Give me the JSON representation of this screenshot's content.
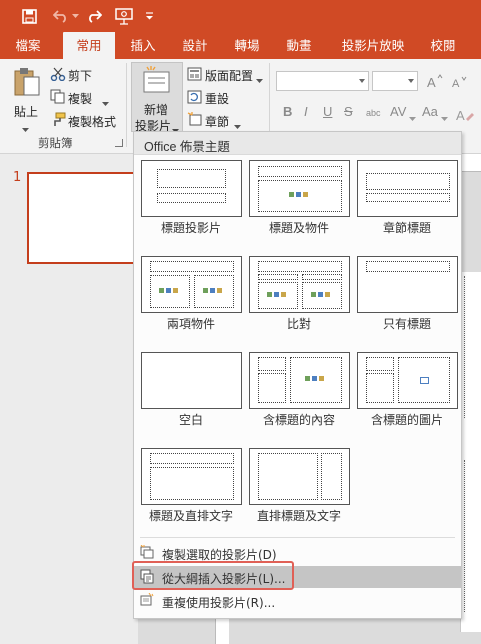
{
  "quick_access": {
    "save_icon": "save-icon",
    "undo_icon": "undo-icon",
    "redo_icon": "redo-icon",
    "present_icon": "present-from-start-icon"
  },
  "tabs": [
    {
      "label": "檔案"
    },
    {
      "label": "常用",
      "active": true
    },
    {
      "label": "插入"
    },
    {
      "label": "設計"
    },
    {
      "label": "轉場"
    },
    {
      "label": "動畫"
    },
    {
      "label": "投影片放映"
    },
    {
      "label": "校閱"
    }
  ],
  "clipboard": {
    "paste": "貼上",
    "cut": "剪下",
    "copy": "複製",
    "format_painter": "複製格式",
    "group_title": "剪貼簿"
  },
  "slides_group": {
    "new_slide_line1": "新增",
    "new_slide_line2": "投影片",
    "layout": "版面配置",
    "reset": "重設",
    "section": "章節"
  },
  "font_group": {
    "bold": "B",
    "italic": "I",
    "underline": "U",
    "strike": "S",
    "shadow": "abc",
    "spacing": "AV",
    "case": "Aa"
  },
  "thumbnails": {
    "slide_number": "1"
  },
  "menu": {
    "header": "Office 佈景主題",
    "layouts": [
      {
        "name": "標題投影片"
      },
      {
        "name": "標題及物件"
      },
      {
        "name": "章節標題"
      },
      {
        "name": "兩項物件"
      },
      {
        "name": "比對"
      },
      {
        "name": "只有標題"
      },
      {
        "name": "空白"
      },
      {
        "name": "含標題的內容"
      },
      {
        "name": "含標題的圖片"
      },
      {
        "name": "標題及直排文字"
      },
      {
        "name": "直排標題及文字"
      }
    ],
    "items": [
      {
        "label": "複製選取的投影片(D)"
      },
      {
        "label": "從大綱插入投影片(L)..."
      },
      {
        "label": "重複使用投影片(R)..."
      }
    ]
  },
  "colors": {
    "accent": "#d04a25",
    "accent_dark": "#c43e1c",
    "highlight_box": "#e06056"
  }
}
